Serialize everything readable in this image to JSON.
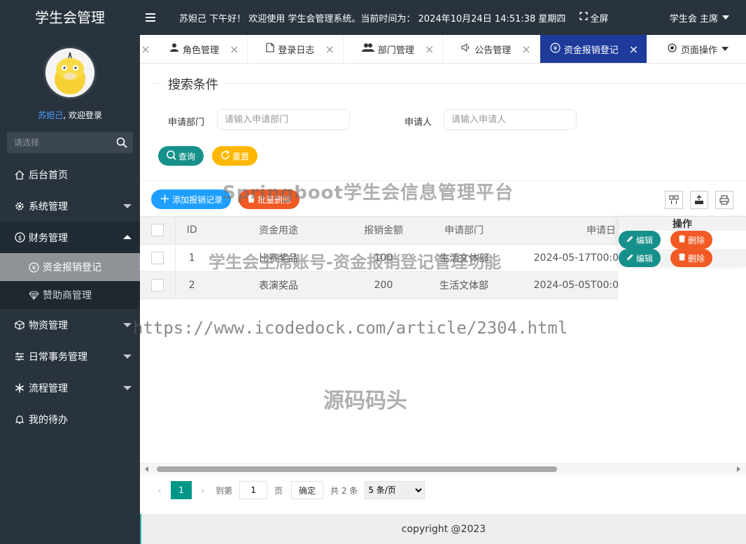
{
  "sidebar": {
    "brand": "学生会管理",
    "username": "苏妲己",
    "welcome_suffix": ", 欢迎登录",
    "search_placeholder": "请选择",
    "menu": [
      {
        "label": "后台首页",
        "icon": "home-icon"
      },
      {
        "label": "系统管理",
        "icon": "gear-icon"
      },
      {
        "label": "财务管理",
        "icon": "dollar-icon"
      },
      {
        "label": "物资管理",
        "icon": "cube-icon"
      },
      {
        "label": "日常事务管理",
        "icon": "sliders-icon"
      },
      {
        "label": "流程管理",
        "icon": "snowflake-icon"
      },
      {
        "label": "我的待办",
        "icon": "bell-icon"
      }
    ],
    "submenu": [
      {
        "label": "资金报销登记",
        "icon": "yen-icon"
      },
      {
        "label": "赞助商管理",
        "icon": "diamond-icon"
      }
    ]
  },
  "header": {
    "greeting": "苏妲己 下午好！ 欢迎使用 学生会管理系统。当前时间为： 2024年10月24日 14:51:38   星期四",
    "fullscreen": "全屏",
    "user_role": "学生会 主席"
  },
  "tabs": [
    {
      "label": "角色管理",
      "icon": "user-icon"
    },
    {
      "label": "登录日志",
      "icon": "file-icon"
    },
    {
      "label": "部门管理",
      "icon": "users-icon"
    },
    {
      "label": "公告管理",
      "icon": "volume-icon"
    },
    {
      "label": "资金报销登记",
      "icon": "yen-icon",
      "active": true
    }
  ],
  "page_ops": "页面操作",
  "search": {
    "legend": "搜索条件",
    "dept_label": "申请部门",
    "dept_placeholder": "请输入申请部门",
    "applicant_label": "申请人",
    "applicant_placeholder": "请输入申请人",
    "query_button": "查询",
    "reset_button": "重置"
  },
  "toolbar": {
    "add_button": "添加报销记录",
    "batch_delete_button": "批量删除"
  },
  "table": {
    "columns": [
      "ID",
      "资金用途",
      "报销金额",
      "申请部门",
      "申请日"
    ],
    "op_header": "操作",
    "rows": [
      {
        "id": "1",
        "purpose": "比赛奖品",
        "amount": "100",
        "dept": "生活文体部",
        "date": "2024-05-17T00:0"
      },
      {
        "id": "2",
        "purpose": "表演奖品",
        "amount": "200",
        "dept": "生活文体部",
        "date": "2024-05-05T00:0"
      }
    ],
    "edit_label": "编辑",
    "delete_label": "删除"
  },
  "pager": {
    "current_page": "1",
    "goto_prefix": "到第",
    "goto_value": "1",
    "page_unit": "页",
    "confirm": "确定",
    "total": "共 2 条",
    "page_size": "5 条/页"
  },
  "footer": "copyright @2023",
  "watermarks": {
    "line1": "Springboot学生会信息管理平台",
    "line2": "学生会主席账号-资金报销登记管理功能",
    "line3": "https://www.icodedock.com/article/2304.html",
    "line4": "源码码头"
  },
  "colors": {
    "sidebar_bg": "#28333e",
    "active_tab": "#1e3b9c",
    "teal": "#16908a",
    "orange": "#f15a24",
    "blue": "#1e9fff",
    "yellow": "#ffb800"
  }
}
